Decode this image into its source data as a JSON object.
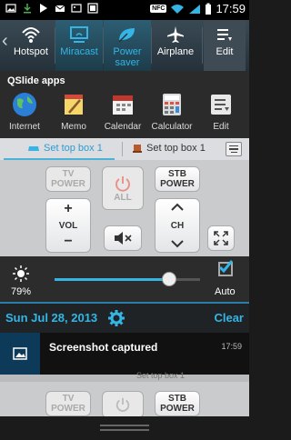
{
  "status_bar": {
    "time": "17:59",
    "nfc_label": "NFC"
  },
  "quick_settings": {
    "items": [
      {
        "label": "Hotspot",
        "icon": "wifi-hotspot-icon"
      },
      {
        "label": "Miracast",
        "icon": "miracast-icon"
      },
      {
        "label": "Power saver",
        "icon": "power-saver-icon"
      },
      {
        "label": "Airplane",
        "icon": "airplane-icon"
      },
      {
        "label": "Edit",
        "icon": "edit-icon"
      }
    ]
  },
  "qslide": {
    "title": "QSlide apps",
    "apps": [
      {
        "label": "Internet"
      },
      {
        "label": "Memo"
      },
      {
        "label": "Calendar"
      },
      {
        "label": "Calculator"
      },
      {
        "label": "Edit"
      }
    ]
  },
  "remote": {
    "tabs": [
      {
        "label": "Set top box 1"
      },
      {
        "label": "Set top box 1"
      }
    ],
    "tv_power": "TV POWER",
    "all_label": "ALL",
    "stb_power": "STB POWER",
    "vol_label": "VOL",
    "ch_label": "CH",
    "plus": "+",
    "minus": "−"
  },
  "brightness": {
    "value": "79%",
    "level": 0.79,
    "auto_label": "Auto"
  },
  "date_bar": {
    "date": "Sun Jul 28, 2013",
    "clear_label": "Clear"
  },
  "notification": {
    "title": "Screenshot captured",
    "time": "17:59"
  },
  "ghost": {
    "tab_label": "Set top box 1",
    "tv_power": "TV POWER",
    "stb_power": "STB POWER"
  },
  "colors": {
    "accent": "#35b5e5"
  }
}
